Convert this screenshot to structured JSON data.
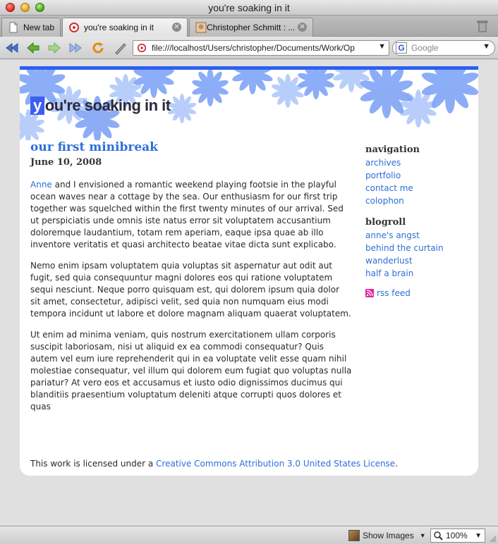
{
  "window": {
    "title": "you're soaking in it"
  },
  "tabs": [
    {
      "label": "New tab",
      "icon": "document-icon",
      "active": false
    },
    {
      "label": "you're soaking in it",
      "icon": "site-favicon",
      "active": true
    },
    {
      "label": "Christopher Schmitt : ...",
      "icon": "avatar-favicon",
      "active": false
    }
  ],
  "toolbar": {
    "url": "file:///localhost/Users/christopher/Documents/Work/Op",
    "search_placeholder": "Google"
  },
  "site": {
    "title_first": "y",
    "title_rest": "ou're soaking in it"
  },
  "post": {
    "title": "our first minibreak",
    "date": "June 10, 2008",
    "p1_link": "Anne",
    "p1_rest": " and I envisioned a romantic weekend playing footsie in the playful ocean waves near a cottage by the sea. Our enthusiasm for our first trip together was squelched within the first twenty minutes of our arrival. Sed ut perspiciatis unde omnis iste natus error sit voluptatem accusantium doloremque laudantium, totam rem aperiam, eaque ipsa quae ab illo inventore veritatis et quasi architecto beatae vitae dicta sunt explicabo.",
    "p2": "Nemo enim ipsam voluptatem quia voluptas sit aspernatur aut odit aut fugit, sed quia consequuntur magni dolores eos qui ratione voluptatem sequi nesciunt. Neque porro quisquam est, qui dolorem ipsum quia dolor sit amet, consectetur, adipisci velit, sed quia non numquam eius modi tempora incidunt ut labore et dolore magnam aliquam quaerat voluptatem.",
    "p3": "Ut enim ad minima veniam, quis nostrum exercitationem ullam corporis suscipit laboriosam, nisi ut aliquid ex ea commodi consequatur? Quis autem vel eum iure reprehenderit qui in ea voluptate velit esse quam nihil molestiae consequatur, vel illum qui dolorem eum fugiat quo voluptas nulla pariatur? At vero eos et accusamus et iusto odio dignissimos ducimus qui blanditiis praesentium voluptatum deleniti atque corrupti quos dolores et quas"
  },
  "sidebar": {
    "nav_heading": "navigation",
    "nav": [
      "archives",
      "portfolio",
      "contact me",
      "colophon"
    ],
    "blogroll_heading": "blogroll",
    "blogroll": [
      "anne's angst",
      "behind the curtain",
      "wanderlust",
      "half a brain"
    ],
    "rss": "rss feed"
  },
  "footer": {
    "license_prefix": "This work is licensed under a ",
    "license_link": "Creative Commons Attribution 3.0 United States License",
    "license_suffix": "."
  },
  "statusbar": {
    "show_images": "Show Images",
    "zoom": "100%"
  },
  "colors": {
    "accent": "#2c5ff5",
    "link": "#2c6fd8",
    "rss": "#e0239b"
  }
}
